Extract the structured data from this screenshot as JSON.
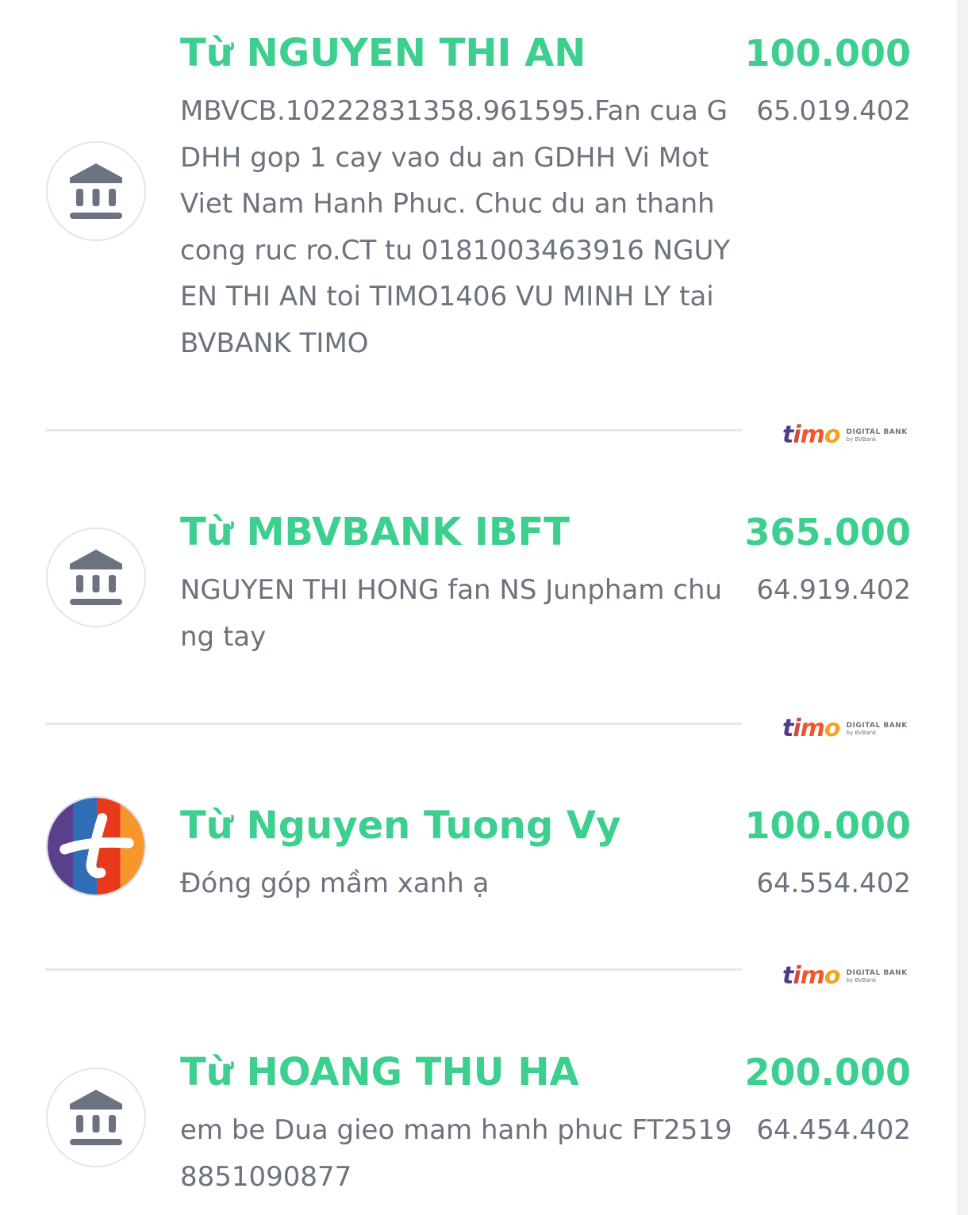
{
  "transactions": [
    {
      "title": "Từ NGUYEN THI AN",
      "amount": "100.000",
      "description": "MBVCB.10222831358.961595.Fan cua GDHH gop 1 cay vao du an GDHH Vi Mot Viet Nam Hanh Phuc. Chuc du an thanh cong ruc ro.CT tu 0181003463916 NGUYEN THI AN toi TIMO1406 VU MINH LY tai BVBANK TIMO",
      "balance": "65.019.402",
      "avatar_icon": "bank-icon"
    },
    {
      "title": "Từ MBVBANK IBFT",
      "amount": "365.000",
      "description": "NGUYEN THI HONG fan NS Junpham chung tay",
      "balance": "64.919.402",
      "avatar_icon": "bank-icon"
    },
    {
      "title": "Từ Nguyen Tuong Vy",
      "amount": "100.000",
      "description": "Đóng góp mầm xanh ạ",
      "balance": "64.554.402",
      "avatar_icon": "plus-app-icon"
    },
    {
      "title": "Từ HOANG THU HA",
      "amount": "200.000",
      "description": "em be Dua gieo mam hanh phuc FT25198851090877",
      "balance": "64.454.402",
      "avatar_icon": "bank-icon"
    }
  ],
  "brand": {
    "name": "timo",
    "tagline": "DIGITAL BANK",
    "sub": "by BVBank"
  },
  "colors": {
    "accent_green": "#3ccf8e",
    "text_gray": "#6c737d",
    "icon_gray": "#6b7280",
    "divider": "#e6e8eb"
  }
}
